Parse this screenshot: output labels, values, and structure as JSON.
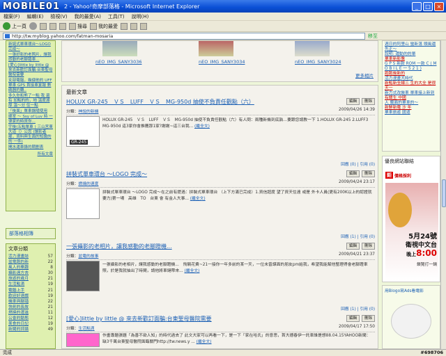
{
  "window": {
    "logo": "MOBILE01",
    "title": "2 - Yahoo!奇摩部落格 - Microsoft Internet Explorer",
    "btn_min": "_",
    "btn_max": "□",
    "btn_close": "×"
  },
  "menu": [
    "檔案(F)",
    "編輯(E)",
    "檢視(V)",
    "我的最愛(A)",
    "工具(T)",
    "說明(H)"
  ],
  "toolbar": {
    "back": "上一頁",
    "search": "搜尋",
    "favorites": "我的最愛"
  },
  "address": {
    "url": "http://tw.myblog.yahoo.com/fatman-mosaria",
    "go": "移至"
  },
  "left": {
    "links": [
      "新誕式單車環台～LOGO 完成～",
      "一張好影的老照片，讓我感動的老腳踏車...",
      "[愛心]little by little @ 來去新歡訂面騙:台東聖母醫院需要",
      "女部電腦，幾個他的 UFF 單車 GPS 首接車宴報 數碼器的轉..",
      "多久你和熊了一點 我 還有 加點的的，地 溫度湖厚 溫～分 住一點",
      "「後面」單車錄隨使用",
      "娜室 ～ Ssy of Luv 時 一律家的時資你...",
      "宇後(五點單車 ) 三山宮東大道（）公您 (讓影者罷，資料與生面的知識的 的 一件)",
      "開水運車錄的期劃表"
    ],
    "all_posts": "所有文章",
    "settings": "部落格相簿",
    "cat_title": "文章分類",
    "categories": [
      [
        "活力漫畫誌",
        "57"
      ],
      [
        "盆電跑的新",
        "22"
      ],
      [
        "風人的樂趣",
        "8"
      ],
      [
        "攝影遠方去",
        "30"
      ],
      [
        "旅遊的歲月",
        "21"
      ],
      [
        "生活點滴",
        "19"
      ],
      [
        "電腦上手",
        "21"
      ],
      [
        "歡迎好速戲",
        "19"
      ],
      [
        "機車與腳踏",
        "22"
      ],
      [
        "快劍的長故",
        "21"
      ],
      [
        "燃燒的運進",
        "11"
      ],
      [
        "公會的動態",
        "12"
      ],
      [
        "美食的日記",
        "19"
      ],
      [
        "新聞的評論",
        "49"
      ]
    ]
  },
  "strip": {
    "captions": [
      "nEO_IMG_SANY3036",
      "nEO_IMG_SANY3034",
      "nEO_IMG_SANY3024"
    ],
    "more": "更多相片"
  },
  "main": {
    "panel_title": "最新文章",
    "posts": [
      {
        "title": "HOLUX GR-245　ＶＳ　LUFF　ＶＳ　MG-950d 抽使不負責任觀點（六）",
        "cat_label": "分類：",
        "cat": "神說的新機",
        "date": "2009/04/26 14:39",
        "body": "HOLUX GR-245　ＶＳ　LUFF　ＶＳ　MG-950d 抽使不負責任觀點（六）有人問：兩種新機到底孰…要跟您請教一下 1.HOLUX GR-245 2.LUFF3 MG-950d 這3家你會推薦那1家?謝謝~這三台我...",
        "readmore": "(繼全文)",
        "foot": "回應 (0) | 引用 (0)",
        "btn_edit": "編輯",
        "btn_del": "刪除",
        "pic_label": "GR-245"
      },
      {
        "title": "拼裝式單車環台 ～LOGO 完成～",
        "cat_label": "分類：",
        "cat": "燃燒的速度",
        "date": "2009/04/24 23:17",
        "body": "拼裝式單車環台 ～LOGO 完成～在之前有提過：拼裝式單車環台 （上下方滿已完成）1.資信超度 望了資天住遠 或是 外卡人員(更有200K以上的認證就要力)第一場　高雄　TO　台東 會 有金人大事...",
        "readmore": "(繼全文)",
        "foot": "回應 (1) | 引用 (0)",
        "btn_edit": "編輯",
        "btn_del": "刪除"
      },
      {
        "title": "一張攝影的老相片，讓我感動的老腳蹬機...",
        "cat_label": "分類：",
        "cat": "盆電的故事",
        "date": "2009/04/21 23:37",
        "body": "一張攝影的老相片，讓我感動的老腳蹬機...　飛騎花費~21一接你一年多前的某一天，一位未曾謀面的朋友pm給我，希望我能幫他整理得會老腳蹬車照，於是我就抽出了時間，請他將車鏈帶來...",
        "readmore": "(繼全文)",
        "foot": "回應 (1) | 引用 (0)",
        "btn_edit": "編輯",
        "btn_del": "刪除"
      },
      {
        "title": "[愛心]little by little @ 來去新歡訂面騙:台東聖母醫院需要",
        "cat_label": "分類：",
        "cat": "生活點滴",
        "date": "2009/04/17 17:50",
        "body": "作畫專題張題「為善不欲人知」的時代過去了 此文大家可以再看一下，是一下「家在哈氏」的意思，首大德春伊一託車誰是想88.04.15YAHOO新聞：缺3千萬台東聖母醫院面臨關門http://tw.news.y ...",
        "readmore": "(繼全文)",
        "btn_edit": "編輯",
        "btn_del": "刪除"
      }
    ]
  },
  "right": {
    "links": [
      "週日的阿里山 蠻新落 頭風還先正～",
      "說明: 運動的的單",
      "單車新影像",
      "G P S 新款 ROM 一款 C ( M O B I L E 一 5 2 1 )",
      "跑跑後新的",
      "活力漫畫大時代",
      "新點新全線三 生的大全 是很 天一",
      "新力式改裝車 單車接上新到",
      "有關生 中國",
      "人 蘭面的單車的～",
      "新鮮新電 沙 年",
      "單車旅遊 國道"
    ],
    "fav_title": "優良網站聯結",
    "ad_badge": "鉅",
    "ad_brand": "價格採利",
    "ad_date_big": "5月24號",
    "ad_line1": "衛視中文台",
    "ad_prefix": "晚上",
    "ad_time": "8:00",
    "ad_note": "鎖覽打一鍋",
    "widget_title": "用Blogo寫Ads看電影"
  },
  "status": {
    "left": "完成",
    "id": "#698706"
  }
}
